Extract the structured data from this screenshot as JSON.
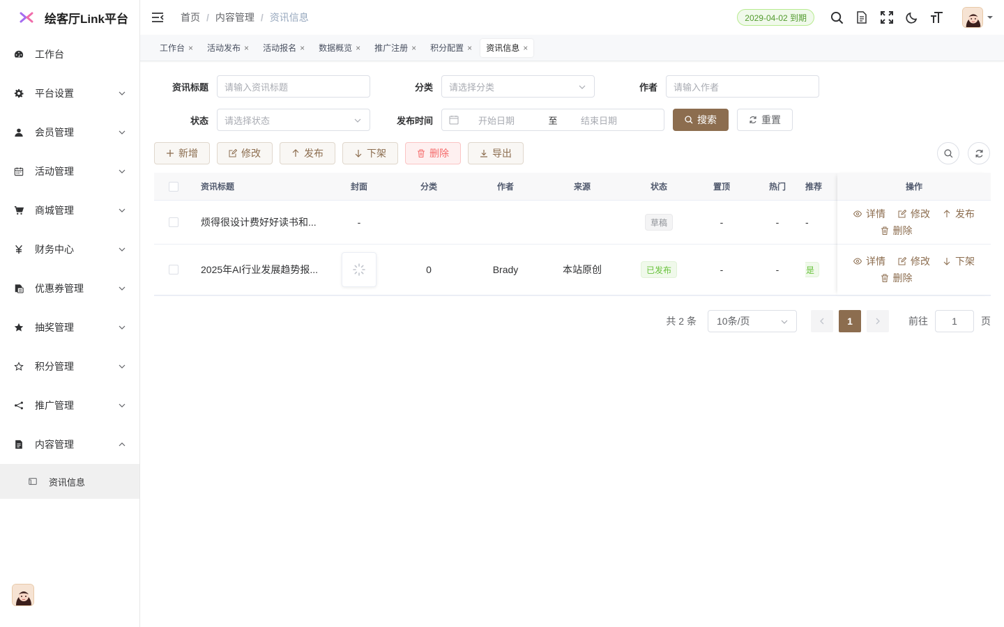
{
  "app": {
    "title": "绘客厅Link平台"
  },
  "sidebar": {
    "items": [
      {
        "label": "工作台",
        "icon": "dashboard-icon"
      },
      {
        "label": "平台设置",
        "icon": "gear-icon"
      },
      {
        "label": "会员管理",
        "icon": "user-icon"
      },
      {
        "label": "活动管理",
        "icon": "calendar-icon"
      },
      {
        "label": "商城管理",
        "icon": "cart-icon"
      },
      {
        "label": "财务中心",
        "icon": "yen-icon"
      },
      {
        "label": "优惠券管理",
        "icon": "coupon-icon"
      },
      {
        "label": "抽奖管理",
        "icon": "star-filled-icon"
      },
      {
        "label": "积分管理",
        "icon": "star-outline-icon"
      },
      {
        "label": "推广管理",
        "icon": "share-icon"
      },
      {
        "label": "内容管理",
        "icon": "document-icon"
      }
    ],
    "subitem": {
      "label": "资讯信息",
      "icon": "news-icon"
    }
  },
  "navbar": {
    "breadcrumb": [
      "首页",
      "内容管理",
      "资讯信息"
    ],
    "sep": "/",
    "expire": "2029-04-02 到期"
  },
  "tags": [
    {
      "label": "工作台",
      "active": false
    },
    {
      "label": "活动发布",
      "active": false
    },
    {
      "label": "活动报名",
      "active": false
    },
    {
      "label": "数据概览",
      "active": false
    },
    {
      "label": "推广注册",
      "active": false
    },
    {
      "label": "积分配置",
      "active": false
    },
    {
      "label": "资讯信息",
      "active": true
    }
  ],
  "tag_close": "×",
  "filters": {
    "title_label": "资讯标题",
    "title_ph": "请输入资讯标题",
    "category_label": "分类",
    "category_ph": "请选择分类",
    "author_label": "作者",
    "author_ph": "请输入作者",
    "status_label": "状态",
    "status_ph": "请选择状态",
    "date_label": "发布时间",
    "date_start_ph": "开始日期",
    "date_to": "至",
    "date_end_ph": "结束日期",
    "search_btn": "搜索",
    "reset_btn": "重置"
  },
  "toolbar": {
    "add": "新增",
    "edit": "修改",
    "publish": "发布",
    "offline": "下架",
    "delete": "删除",
    "export": "导出"
  },
  "table": {
    "headers": {
      "title": "资讯标题",
      "cover": "封面",
      "category": "分类",
      "author": "作者",
      "source": "来源",
      "status": "状态",
      "top": "置顶",
      "hot": "热门",
      "rec": "推荐",
      "ops": "操作"
    },
    "rows": [
      {
        "title": "烦得很设计费好好读书和...",
        "cover": "-",
        "category": "",
        "author": "",
        "source": "",
        "status": "草稿",
        "top": "-",
        "hot": "-",
        "rec": "-",
        "ops": [
          "详情",
          "修改",
          "发布",
          "删除"
        ]
      },
      {
        "title": "2025年AI行业发展趋势报...",
        "cover": "",
        "category": "0",
        "author": "Brady",
        "source": "本站原创",
        "status": "已发布",
        "top": "-",
        "hot": "-",
        "rec": "是",
        "ops": [
          "详情",
          "修改",
          "下架",
          "删除"
        ]
      }
    ]
  },
  "pagination": {
    "total": "共 2 条",
    "size": "10条/页",
    "current": "1",
    "goto_label": "前往",
    "goto_value": "1",
    "page_suffix": "页"
  },
  "colors": {
    "primary": "#8c6d4f",
    "success": "#67c23a",
    "danger": "#f56c6c"
  }
}
